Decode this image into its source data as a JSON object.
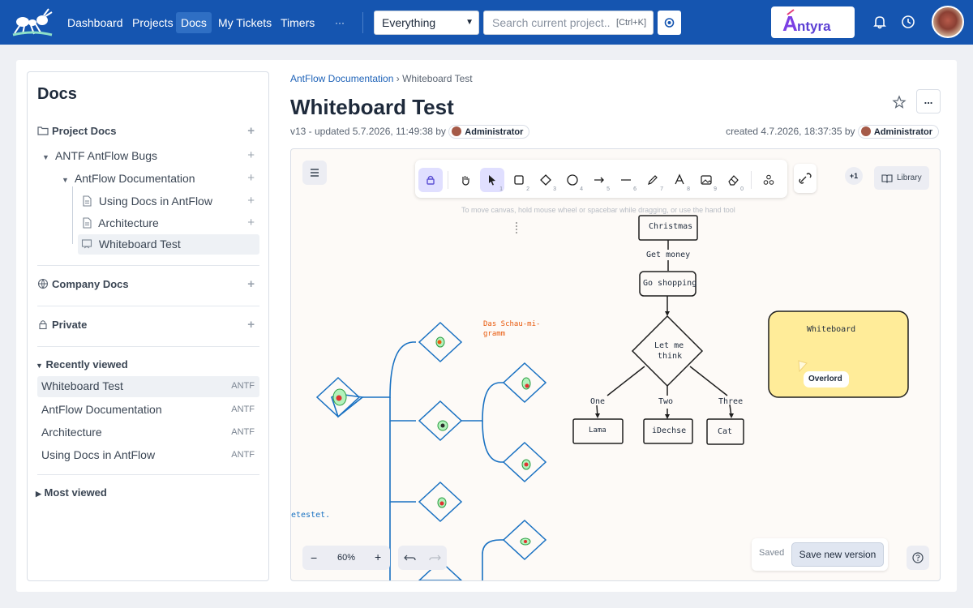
{
  "nav": {
    "items": [
      "Dashboard",
      "Projects",
      "Docs",
      "My Tickets",
      "Timers"
    ],
    "more": "···",
    "active": "Docs"
  },
  "search": {
    "scope": "Everything",
    "placeholder": "Search current project..",
    "shortcut": "[Ctrl+K]"
  },
  "brand": {
    "logo_text": "Antyra"
  },
  "sidebar": {
    "title": "Docs",
    "project_docs": "Project Docs",
    "tree": [
      "ANTF AntFlow Bugs",
      "AntFlow Documentation",
      "Using Docs in AntFlow",
      "Architecture",
      "Whiteboard Test"
    ],
    "company_docs": "Company Docs",
    "private": "Private",
    "recently_viewed": {
      "label": "Recently viewed",
      "items": [
        {
          "name": "Whiteboard Test",
          "project": "ANTF"
        },
        {
          "name": "AntFlow Documentation",
          "project": "ANTF"
        },
        {
          "name": "Architecture",
          "project": "ANTF"
        },
        {
          "name": "Using Docs in AntFlow",
          "project": "ANTF"
        }
      ]
    },
    "most_viewed": "Most viewed"
  },
  "doc": {
    "breadcrumb_parent": "AntFlow Documentation",
    "breadcrumb_sep": "›",
    "breadcrumb_current": "Whiteboard Test",
    "title": "Whiteboard Test",
    "version_text": "v13 - updated 5.7.2026, 11:49:38 by",
    "updated_by": "Administrator",
    "created_text": "created 4.7.2026, 18:37:35 by",
    "created_by": "Administrator",
    "more": "..."
  },
  "whiteboard": {
    "tool_numbers": [
      "1",
      "2",
      "3",
      "4",
      "5",
      "6",
      "7",
      "8",
      "9",
      "0"
    ],
    "collaborators": "+1",
    "library": "Library",
    "hint": "To move canvas, hold mouse wheel or spacebar while dragging, or use the hand tool",
    "zoom": "60%",
    "zoom_out": "−",
    "zoom_in": "+",
    "saved": "Saved",
    "save_version": "Save new version",
    "shapes": {
      "christmas": "Christmas",
      "get_money": "Get money",
      "go_shopping": "Go shopping",
      "let_me": "Let me",
      "think": "think",
      "one": "One",
      "two": "Two",
      "three": "Three",
      "lama": "Lama",
      "idechse": "iDechse",
      "cat": "Cat",
      "whiteboard": "Whiteboard",
      "overlord": "Overlord",
      "schau1": "Das Schau-mi-",
      "schau2": "gramm",
      "etestet": "etestet."
    }
  },
  "colors": {
    "header": "#1555b0",
    "accent": "#1f63b8",
    "tool_active": "#e0dfff",
    "sticky": "#fde68a"
  }
}
